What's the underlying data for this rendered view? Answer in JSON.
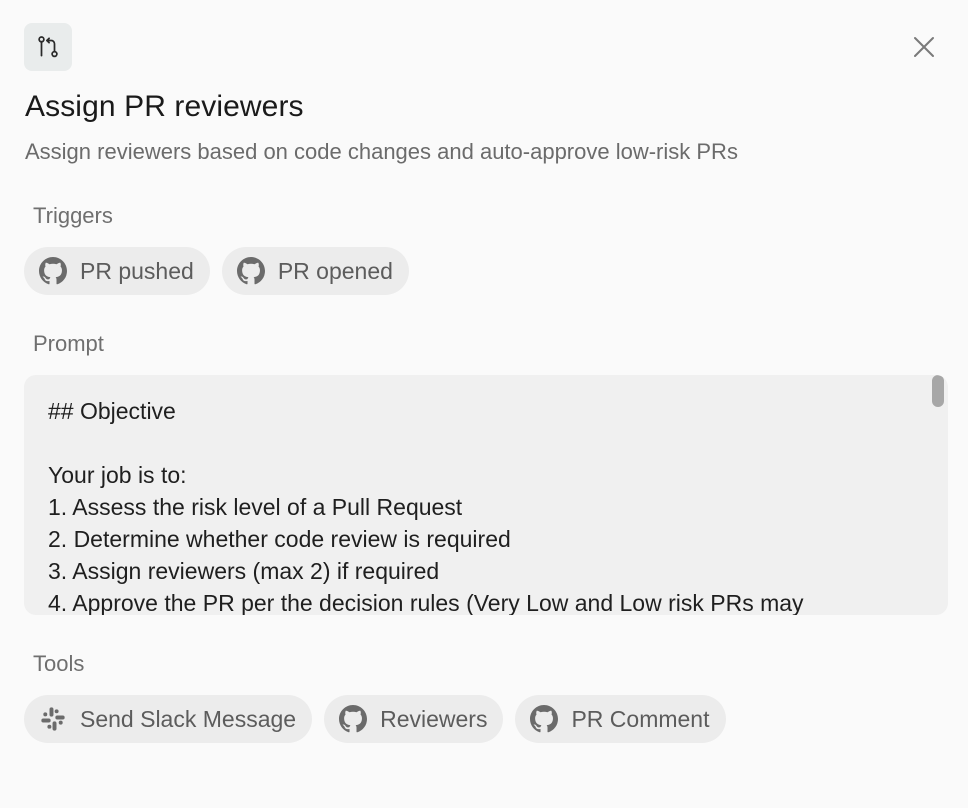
{
  "header": {
    "icon": "git-pull-request-icon",
    "title": "Assign PR reviewers",
    "subtitle": "Assign reviewers based on code changes and auto-approve low-risk PRs",
    "close_icon": "close-icon"
  },
  "triggers": {
    "label": "Triggers",
    "items": [
      {
        "label": "PR pushed",
        "icon": "github-icon"
      },
      {
        "label": "PR opened",
        "icon": "github-icon"
      }
    ]
  },
  "prompt": {
    "label": "Prompt",
    "text": "## Objective\n\nYour job is to:\n1. Assess the risk level of a Pull Request\n2. Determine whether code review is required\n3. Assign reviewers (max 2) if required\n4. Approve the PR per the decision rules (Very Low and Low risk PRs may"
  },
  "tools": {
    "label": "Tools",
    "items": [
      {
        "label": "Send Slack Message",
        "icon": "slack-icon"
      },
      {
        "label": "Reviewers",
        "icon": "github-icon"
      },
      {
        "label": "PR Comment",
        "icon": "github-icon"
      }
    ]
  },
  "colors": {
    "background": "#fafafa",
    "chip_bg": "#ececec",
    "prompt_bg": "#f0f0f0",
    "icon_tile_bg": "#e9ecec"
  }
}
